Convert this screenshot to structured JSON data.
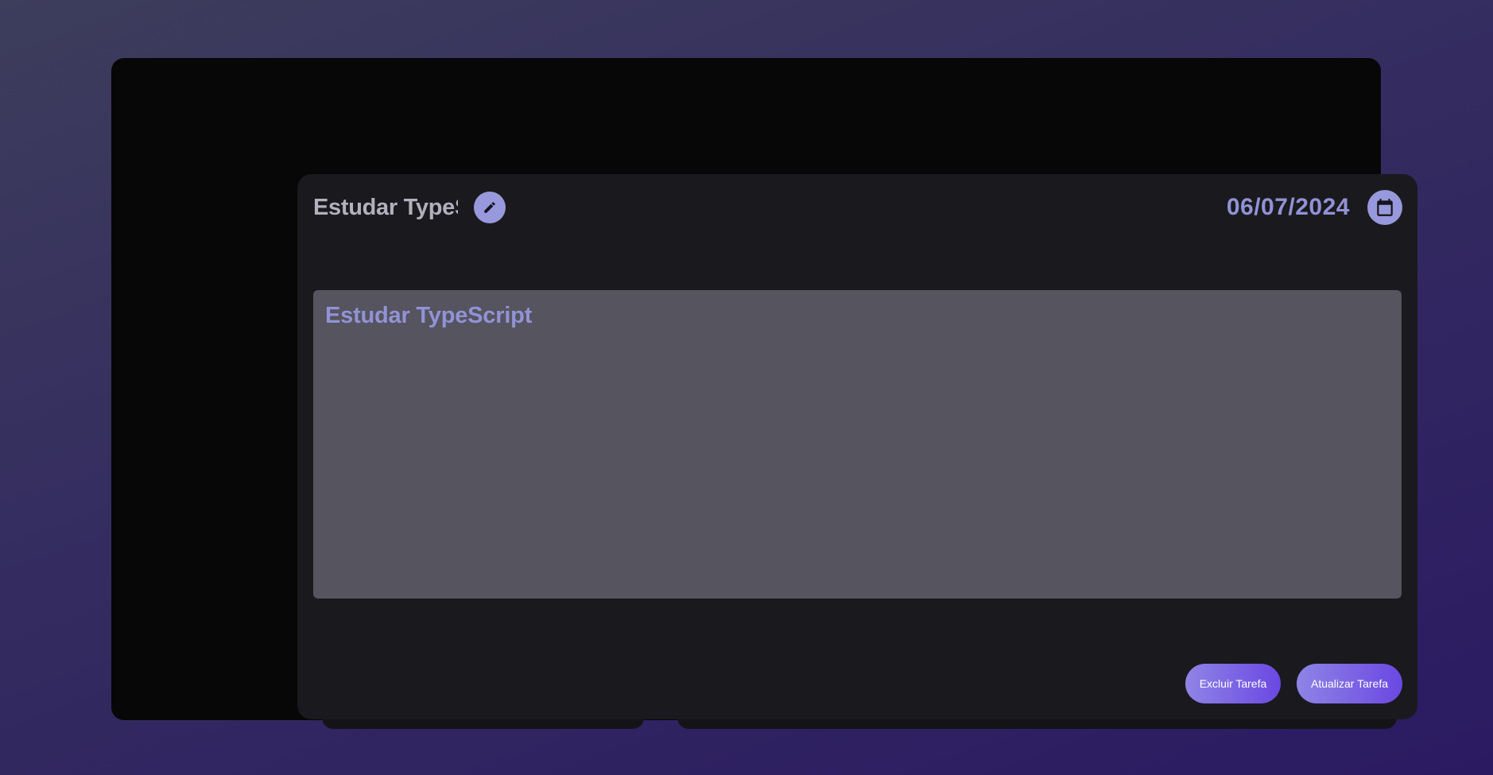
{
  "task": {
    "title": "Estudar TypeScript",
    "date": "06/07/2024",
    "description": "Estudar TypeScript"
  },
  "actions": {
    "delete_label": "Excluir Tarefa",
    "update_label": "Atualizar Tarefa"
  },
  "icons": {
    "edit": "pencil-icon",
    "calendar": "calendar-icon"
  },
  "colors": {
    "accent": "#9898dc",
    "accent_text": "#9292d6",
    "button_gradient_start": "#8f84e6",
    "button_gradient_end": "#6a48e2",
    "card_background": "#1a191e",
    "description_background": "#55545f"
  }
}
